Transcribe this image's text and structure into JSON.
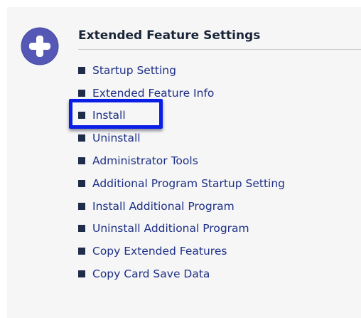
{
  "colors": {
    "background": "#f6f6f6",
    "icon_fill": "#5558b5",
    "title_text": "#1a2638",
    "link_text": "#1d2f86",
    "bullet": "#1f2d4a",
    "highlight_border": "#0a1fe6"
  },
  "section": {
    "icon": "plus-circle-icon",
    "title": "Extended Feature Settings",
    "items": [
      {
        "label": "Startup Setting",
        "highlighted": false
      },
      {
        "label": "Extended Feature Info",
        "highlighted": false
      },
      {
        "label": "Install",
        "highlighted": true
      },
      {
        "label": "Uninstall",
        "highlighted": false
      },
      {
        "label": "Administrator Tools",
        "highlighted": false
      },
      {
        "label": "Additional Program Startup Setting",
        "highlighted": false
      },
      {
        "label": "Install Additional Program",
        "highlighted": false
      },
      {
        "label": "Uninstall Additional Program",
        "highlighted": false
      },
      {
        "label": "Copy Extended Features",
        "highlighted": false
      },
      {
        "label": "Copy Card Save Data",
        "highlighted": false
      }
    ]
  }
}
